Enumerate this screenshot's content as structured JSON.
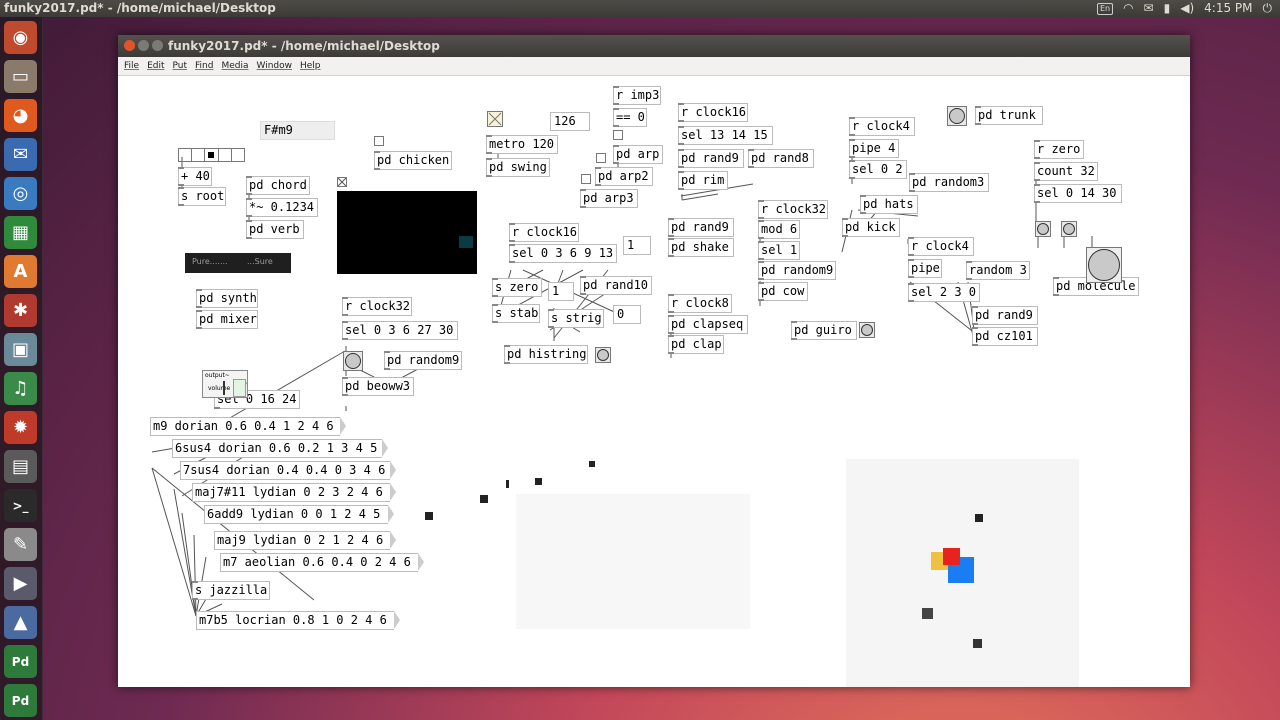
{
  "topbar": {
    "title": "funky2017.pd* - /home/michael/Desktop",
    "keyboard": "En",
    "time": "4:15 PM"
  },
  "launcher": [
    {
      "name": "ubuntu-logo-icon",
      "glyph": "◉",
      "bg": "#c04a2e"
    },
    {
      "name": "files-icon",
      "glyph": "▭",
      "bg": "#8a7a6a"
    },
    {
      "name": "firefox-icon",
      "glyph": "◕",
      "bg": "#e05a20"
    },
    {
      "name": "thunderbird-icon",
      "glyph": "✉",
      "bg": "#3a6ab0"
    },
    {
      "name": "chromium-icon",
      "glyph": "◎",
      "bg": "#3a7ac0"
    },
    {
      "name": "spreadsheet-icon",
      "glyph": "▦",
      "bg": "#2f8a3c"
    },
    {
      "name": "software-center-icon",
      "glyph": "A",
      "bg": "#e07a30"
    },
    {
      "name": "settings-icon",
      "glyph": "✱",
      "bg": "#b03a30"
    },
    {
      "name": "image-viewer-icon",
      "glyph": "▣",
      "bg": "#6a8a9a"
    },
    {
      "name": "lmms-icon",
      "glyph": "♫",
      "bg": "#3a8a4a"
    },
    {
      "name": "fire-app-icon",
      "glyph": "✹",
      "bg": "#c03a2a"
    },
    {
      "name": "calculator-icon",
      "glyph": "▤",
      "bg": "#5a5a5a"
    },
    {
      "name": "terminal-icon",
      "glyph": ">_",
      "bg": "#2a2a2a"
    },
    {
      "name": "text-editor-icon",
      "glyph": "✎",
      "bg": "#8a8a8a"
    },
    {
      "name": "video-editor-icon",
      "glyph": "▶",
      "bg": "#5a5a6a"
    },
    {
      "name": "presentation-icon",
      "glyph": "▲",
      "bg": "#4a6aa0"
    },
    {
      "name": "puredata-icon",
      "glyph": "Pd",
      "bg": "#2e7a3a"
    },
    {
      "name": "puredata-icon-2",
      "glyph": "Pd",
      "bg": "#2e7a3a"
    }
  ],
  "window": {
    "title": "funky2017.pd* - /home/michael/Desktop",
    "menu": [
      "File",
      "Edit",
      "Put",
      "Find",
      "Media",
      "Window",
      "Help"
    ]
  },
  "patch": {
    "symbol_fsharp": "F#m9",
    "plus40": "+ 40",
    "s_root": "s root",
    "pd_chicken": "pd chicken",
    "pd_chord": "pd chord",
    "gain": "*~ 0.1234",
    "pd_verb": "pd verb",
    "pure_label": "Pure.......",
    "sure_label": "...Sure",
    "pd_synth": "pd synth",
    "pd_mixer": "pd mixer",
    "output_label": "output~",
    "volume_label": "volume",
    "dsp_label": "dsp",
    "metro": "metro 120",
    "metro_num": "126",
    "pd_swing": "pd swing",
    "r_imp3": "r imp3",
    "eq_zero": "== 0",
    "pd_arp": "pd arp",
    "pd_arp2": "pd arp2",
    "pd_arp3": "pd arp3",
    "r_clock16_a": "r clock16",
    "sel_13": "sel 13 14 15",
    "pd_rand9_a": "pd rand9",
    "pd_rand8": "pd rand8",
    "pd_rim": "pd rim",
    "r_clock16_b": "r clock16",
    "sel_0_3": "sel 0 3 6 9 13",
    "num_one_a": "1",
    "s_zero": "s zero",
    "num_one_b": "1",
    "pd_rand10": "pd rand10",
    "s_stab": "s stab",
    "s_strig": "s strig",
    "num_zero": "0",
    "pd_rand9_b": "pd rand9",
    "pd_shake": "pd shake",
    "r_clock32_a": "r clock32",
    "mod6": "mod 6",
    "sel1": "sel 1",
    "pd_random9_a": "pd random9",
    "pd_cow": "pd cow",
    "r_clock8": "r clock8",
    "pd_clapseq": "pd clapseq",
    "pd_clap": "pd clap",
    "pd_guiro": "pd guiro",
    "r_clock4_a": "r clock4",
    "pipe4": "pipe 4",
    "sel_0_2": "sel 0 2",
    "pd_random3": "pd random3",
    "pd_hats": "pd hats",
    "pd_kick": "pd kick",
    "pd_trunk": "pd trunk",
    "r_zero": "r zero",
    "count32": "count 32",
    "sel_0_14_30": "sel 0 14 30",
    "r_clock4_b": "r clock4",
    "pipe": "pipe",
    "random3": "random 3",
    "sel_2_3_0": "sel 2 3 0",
    "pd_rand9_c": "pd rand9",
    "pd_cz101": "pd cz101",
    "pd_molecule": "pd molecule",
    "r_clock32_b": "r clock32",
    "sel_0_3_6_27_30": "sel 0 3 6 27 30",
    "pd_random9_b": "pd random9",
    "pd_beoww3": "pd beoww3",
    "pd_histring": "pd histring",
    "sel_0_16_24": "sel 0 16 24",
    "m9": "m9 dorian 0.6 0.4 1 2 4 6",
    "sus4_6": "6sus4 dorian 0.6 0.2 1 3 4 5",
    "sus4_7": "7sus4 dorian 0.4 0.4 0 3 4 6",
    "maj7s11": "maj7#11 lydian 0 2 3 2 4 6",
    "add9_6": "6add9 lydian 0 0 1 2 4 5",
    "maj9": "maj9 lydian 0 2 1 2 4 6",
    "m7": "m7 aeolian 0.6 0.4 0 2 4 6",
    "s_jazzilla": "s jazzilla",
    "m7b5": "m7b5 locrian 0.8 1 0 2 4 6"
  },
  "colors": {
    "molecule_red": "#e8221c",
    "molecule_blue": "#1a7ef2",
    "molecule_yellow": "#f0c040",
    "gop_bg": "#000000",
    "gop_square": "#0a3a44"
  }
}
